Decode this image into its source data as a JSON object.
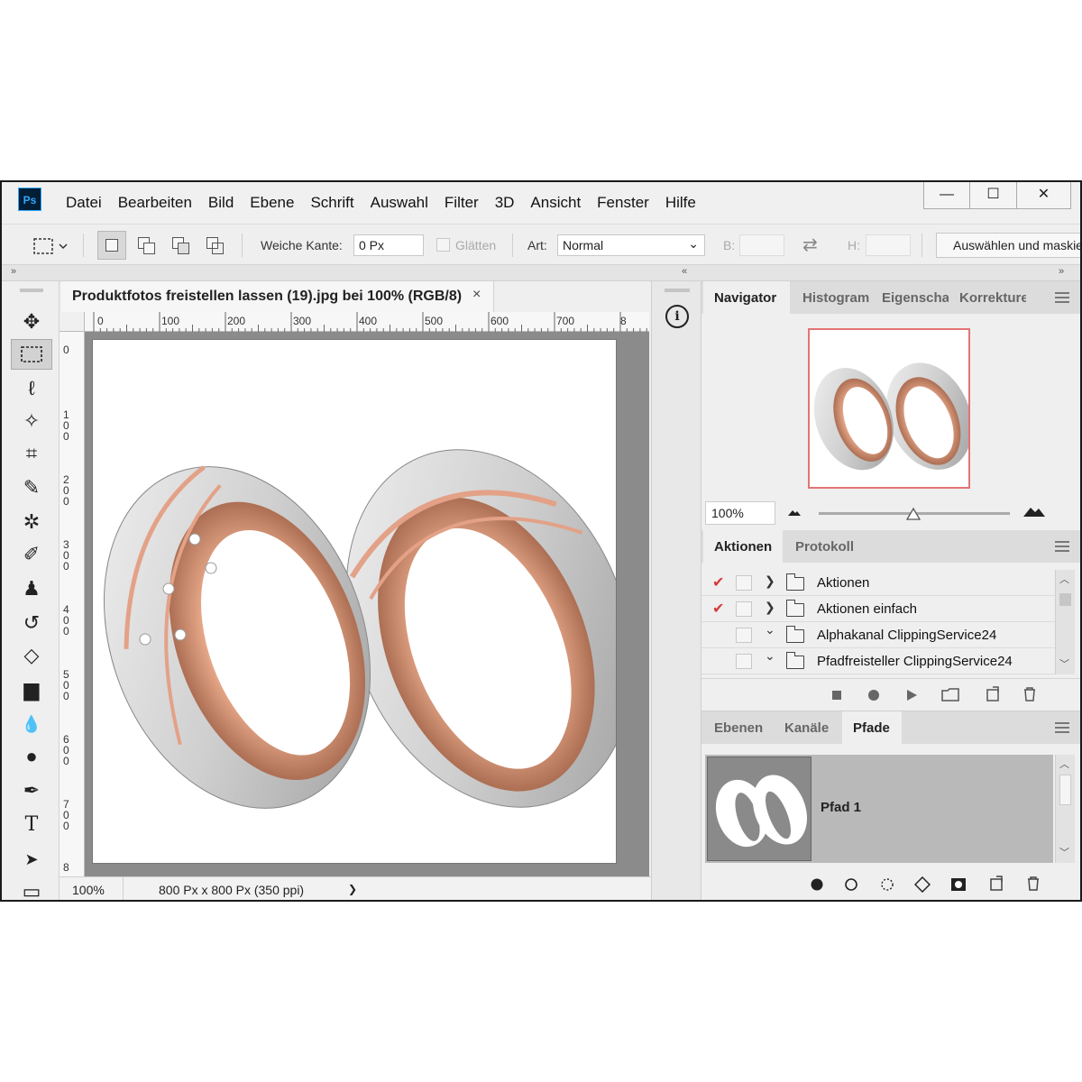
{
  "menubar": {
    "logo": "Ps",
    "items": [
      "Datei",
      "Bearbeiten",
      "Bild",
      "Ebene",
      "Schrift",
      "Auswahl",
      "Filter",
      "3D",
      "Ansicht",
      "Fenster",
      "Hilfe"
    ],
    "window_controls": [
      "—",
      "☐",
      "✕"
    ]
  },
  "options": {
    "feather_label": "Weiche Kante:",
    "feather_value": "0 Px",
    "antialias_label": "Glätten",
    "style_label": "Art:",
    "style_value": "Normal",
    "width_label": "B:",
    "height_label": "H:",
    "select_mask_label": "Auswählen und maskieren..."
  },
  "strip": {
    "left": "»",
    "mid": "«",
    "right": "»"
  },
  "document": {
    "tab_title": "Produktfotos freistellen lassen (19).jpg bei 100% (RGB/8)",
    "close": "×",
    "ruler_top": [
      "0",
      "100",
      "200",
      "300",
      "400",
      "500",
      "600",
      "700",
      "8"
    ],
    "ruler_left": [
      "0",
      "1\n0\n0",
      "2\n0\n0",
      "3\n0\n0",
      "4\n0\n0",
      "5\n0\n0",
      "6\n0\n0",
      "7\n0\n0",
      "8"
    ],
    "zoom": "100%",
    "doc_info": "800 Px x 800 Px (350 ppi)",
    "status_arrow": "❯"
  },
  "tools": [
    {
      "name": "move-tool",
      "glyph": "✥"
    },
    {
      "name": "marquee-tool",
      "glyph": "⬚"
    },
    {
      "name": "lasso-tool",
      "glyph": "ℓ"
    },
    {
      "name": "magic-wand-tool",
      "glyph": "✧"
    },
    {
      "name": "crop-tool",
      "glyph": "⌗"
    },
    {
      "name": "eyedropper-tool",
      "glyph": "✎"
    },
    {
      "name": "healing-brush-tool",
      "glyph": "✲"
    },
    {
      "name": "brush-tool",
      "glyph": "✐"
    },
    {
      "name": "stamp-tool",
      "glyph": "♟"
    },
    {
      "name": "history-brush-tool",
      "glyph": "↺"
    },
    {
      "name": "eraser-tool",
      "glyph": "◇"
    },
    {
      "name": "gradient-tool",
      "glyph": "▆"
    },
    {
      "name": "blur-tool",
      "glyph": "💧"
    },
    {
      "name": "dodge-tool",
      "glyph": "●"
    },
    {
      "name": "pen-tool",
      "glyph": "✒"
    },
    {
      "name": "type-tool",
      "glyph": "T"
    },
    {
      "name": "path-selection-tool",
      "glyph": "➤"
    },
    {
      "name": "rectangle-tool",
      "glyph": "▭"
    }
  ],
  "navigator": {
    "tabs": [
      "Navigator",
      "Histogram",
      "Eigenschaf",
      "Korrekture"
    ],
    "zoom": "100%"
  },
  "actions": {
    "tabs": [
      "Aktionen",
      "Protokoll"
    ],
    "rows": [
      {
        "checked": true,
        "label": "Aktionen",
        "expanded": false
      },
      {
        "checked": true,
        "label": "Aktionen einfach",
        "expanded": false
      },
      {
        "checked": false,
        "label": "Alphakanal ClippingService24",
        "expanded": true
      },
      {
        "checked": false,
        "label": "Pfadfreisteller ClippingService24",
        "expanded": true
      }
    ],
    "check_glyph": "✔",
    "collapsed_glyph": "❯",
    "expanded_glyph": "⌄"
  },
  "layers": {
    "tabs": [
      "Ebenen",
      "Kanäle",
      "Pfade"
    ],
    "path_name": "Pfad 1"
  },
  "colors": {
    "rose_gold": "#d9967c",
    "silver": "#d6d6d6",
    "nav_border": "#e57373"
  }
}
